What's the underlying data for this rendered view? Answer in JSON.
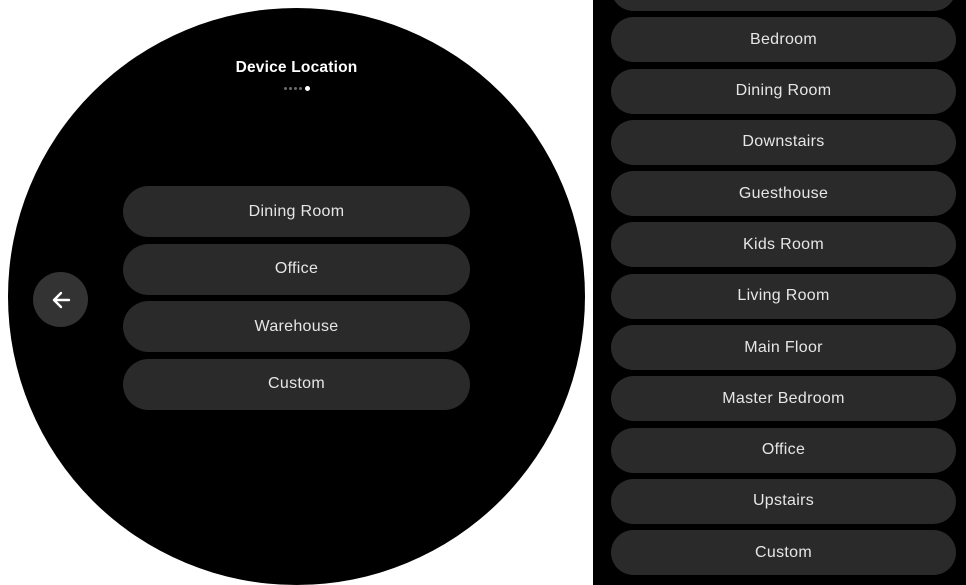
{
  "watch": {
    "title": "Device Location",
    "page_indicator": {
      "total": 5,
      "current": 5
    },
    "options": [
      "Dining  Room",
      "Office",
      "Warehouse",
      "Custom"
    ],
    "back_icon": "arrow-left-icon"
  },
  "panel": {
    "options": [
      "",
      "Bedroom",
      "Dining Room",
      "Downstairs",
      "Guesthouse",
      "Kids Room",
      "Living Room",
      "Main Floor",
      "Master Bedroom",
      "Office",
      "Upstairs",
      "Custom"
    ]
  },
  "colors": {
    "background": "#000000",
    "button": "#2a2a2a",
    "text": "#e6e6e6",
    "back_button": "#333333",
    "dot_inactive": "#6a6a6a",
    "dot_active": "#ffffff"
  }
}
